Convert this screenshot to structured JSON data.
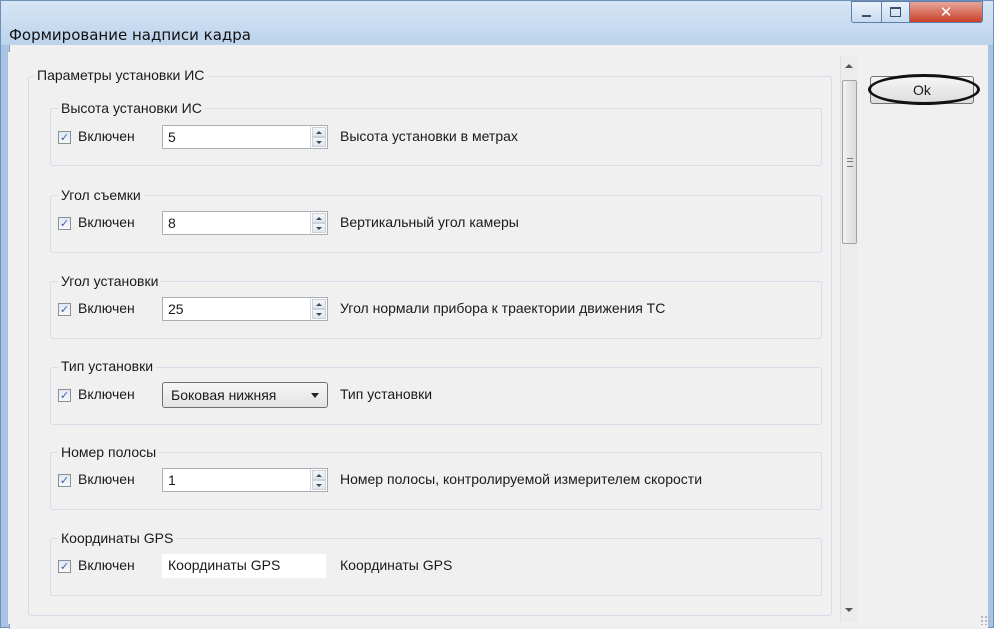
{
  "window": {
    "title": "Формирование надписи кадра",
    "controls": {
      "minimize": "minimize-icon",
      "maximize": "maximize-icon",
      "close": "close-icon"
    }
  },
  "main": {
    "group_title": "Параметры установки ИС",
    "checkbox_label": "Включен",
    "sections": [
      {
        "title": "Высота установки ИС",
        "checked": true,
        "control": "spin",
        "value": "5",
        "description": "Высота установки в метрах"
      },
      {
        "title": "Угол съемки",
        "checked": true,
        "control": "spin",
        "value": "8",
        "description": "Вертикальный угол камеры"
      },
      {
        "title": "Угол установки",
        "checked": true,
        "control": "spin",
        "value": "25",
        "description": "Угол нормали прибора к траектории движения ТС"
      },
      {
        "title": "Тип установки",
        "checked": true,
        "control": "select",
        "value": "Боковая нижняя",
        "description": "Тип установки"
      },
      {
        "title": "Номер полосы",
        "checked": true,
        "control": "spin",
        "value": "1",
        "description": "Номер полосы, контролируемой измерителем скорости"
      },
      {
        "title": "Координаты GPS",
        "checked": true,
        "control": "text",
        "value": "Координаты GPS",
        "description": "Координаты GPS"
      }
    ]
  },
  "side": {
    "ok_label": "Ok"
  },
  "icons": {
    "checkmark": "checkmark-icon",
    "spin_up": "spin-up-icon",
    "spin_down": "spin-down-icon",
    "dropdown": "chevron-down-icon"
  },
  "colors": {
    "titlebar": "#bcd3ec",
    "close": "#c8402a",
    "panel": "#f0f0f0"
  }
}
